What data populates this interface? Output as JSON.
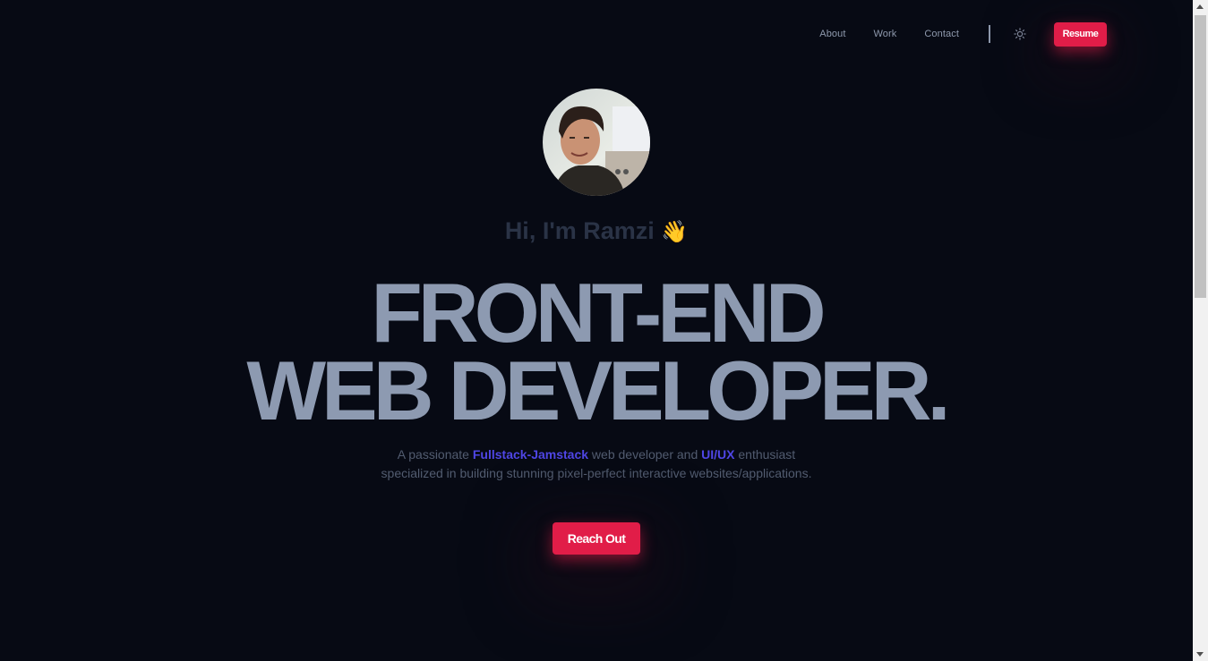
{
  "nav": {
    "links": [
      {
        "label": "About"
      },
      {
        "label": "Work"
      },
      {
        "label": "Contact"
      }
    ],
    "theme_icon": "sun-icon",
    "resume_label": "Resume"
  },
  "hero": {
    "greeting": "Hi, I'm Ramzi",
    "wave_emoji": "👋",
    "headline_line1": "FRONT-END",
    "headline_line2": "WEB DEVELOPER.",
    "subtitle": {
      "part1": "A passionate ",
      "highlight1": "Fullstack-Jamstack",
      "part2": " web developer and ",
      "highlight2": "UI/UX",
      "part3": " enthusiast specialized in building stunning pixel-perfect interactive websites/applications."
    },
    "cta_label": "Reach Out"
  },
  "colors": {
    "background": "#070a14",
    "accent": "#e11d48",
    "highlight": "#4f46e5",
    "headline": "#8d9ab1"
  }
}
